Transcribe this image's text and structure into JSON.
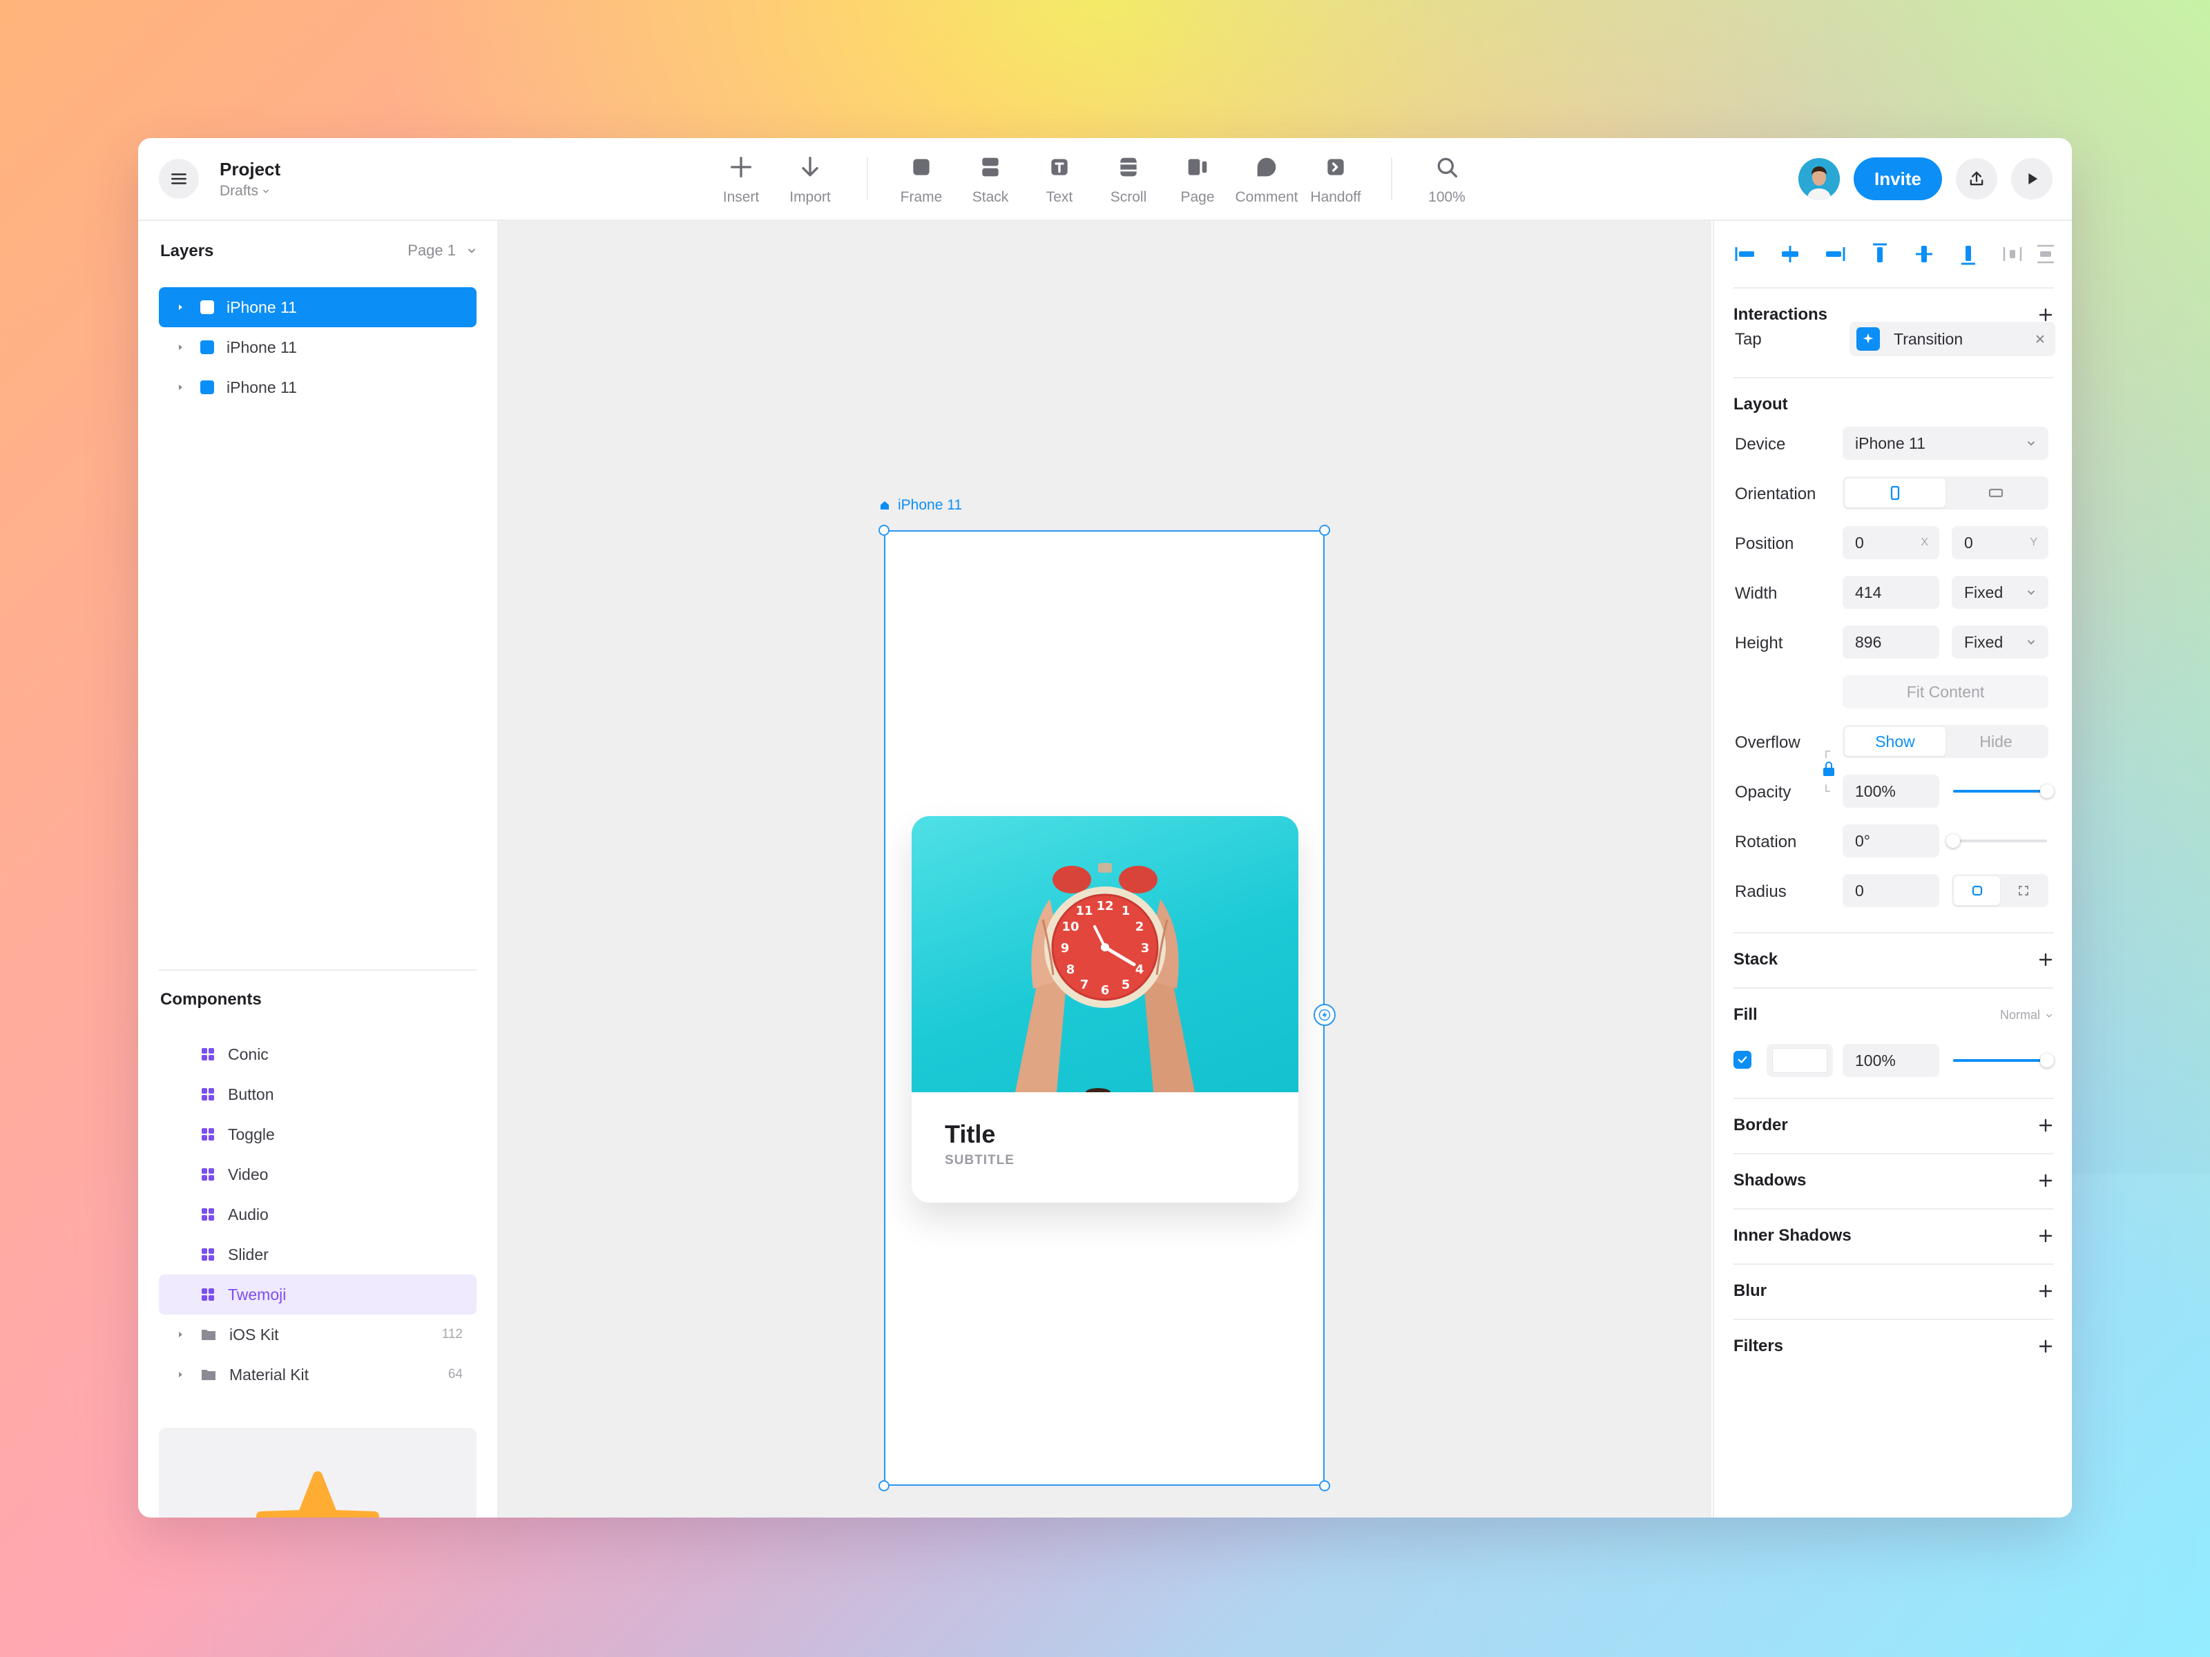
{
  "project": {
    "title": "Project",
    "subtitle": "Drafts"
  },
  "toolbar": {
    "tools": [
      {
        "label": "Insert",
        "icon": "plus-icon"
      },
      {
        "label": "Import",
        "icon": "arrow-down-icon"
      },
      {
        "label": "Frame",
        "icon": "frame-icon"
      },
      {
        "label": "Stack",
        "icon": "stack-icon"
      },
      {
        "label": "Text",
        "icon": "text-icon"
      },
      {
        "label": "Scroll",
        "icon": "scroll-icon"
      },
      {
        "label": "Page",
        "icon": "page-icon"
      },
      {
        "label": "Comment",
        "icon": "comment-icon"
      },
      {
        "label": "Handoff",
        "icon": "handoff-icon"
      },
      {
        "label": "100%",
        "icon": "search-icon"
      }
    ],
    "invite_label": "Invite"
  },
  "layers": {
    "header": "Layers",
    "page_select": "Page 1",
    "items": [
      {
        "label": "iPhone 11",
        "selected": true
      },
      {
        "label": "iPhone 11",
        "selected": false
      },
      {
        "label": "iPhone 11",
        "selected": false
      }
    ]
  },
  "components": {
    "header": "Components",
    "items": [
      {
        "label": "Conic"
      },
      {
        "label": "Button"
      },
      {
        "label": "Toggle"
      },
      {
        "label": "Video"
      },
      {
        "label": "Audio"
      },
      {
        "label": "Slider"
      },
      {
        "label": "Twemoji",
        "highlighted": true
      }
    ],
    "folders": [
      {
        "label": "iOS Kit",
        "count": "112"
      },
      {
        "label": "Material Kit",
        "count": "64"
      }
    ],
    "preview_icon": "star-icon"
  },
  "canvas": {
    "frame_label": "iPhone 11",
    "card": {
      "title": "Title",
      "subtitle": "SUBTITLE"
    }
  },
  "inspector": {
    "interactions": {
      "title": "Interactions",
      "trigger": "Tap",
      "action": "Transition"
    },
    "layout": {
      "title": "Layout",
      "device_label": "Device",
      "device_value": "iPhone 11",
      "orientation_label": "Orientation",
      "position_label": "Position",
      "x_value": "0",
      "x_suffix": "X",
      "y_value": "0",
      "y_suffix": "Y",
      "width_label": "Width",
      "width_value": "414",
      "width_mode": "Fixed",
      "height_label": "Height",
      "height_value": "896",
      "height_mode": "Fixed",
      "fit_content": "Fit Content",
      "overflow_label": "Overflow",
      "overflow_show": "Show",
      "overflow_hide": "Hide",
      "opacity_label": "Opacity",
      "opacity_value": "100%",
      "opacity_level": 1.0,
      "rotation_label": "Rotation",
      "rotation_value": "0°",
      "rotation_level": 0.0,
      "radius_label": "Radius",
      "radius_value": "0"
    },
    "stack": {
      "title": "Stack"
    },
    "fill": {
      "title": "Fill",
      "blend": "Normal",
      "opacity_value": "100%",
      "opacity_level": 1.0,
      "color": "#FFFFFF"
    },
    "border": {
      "title": "Border"
    },
    "shadows": {
      "title": "Shadows"
    },
    "inner_shadows": {
      "title": "Inner Shadows"
    },
    "blur": {
      "title": "Blur"
    },
    "filters": {
      "title": "Filters"
    }
  },
  "colors": {
    "accent": "#0B8EF6",
    "component": "#7C4FF0",
    "star": "#FFAC33"
  }
}
